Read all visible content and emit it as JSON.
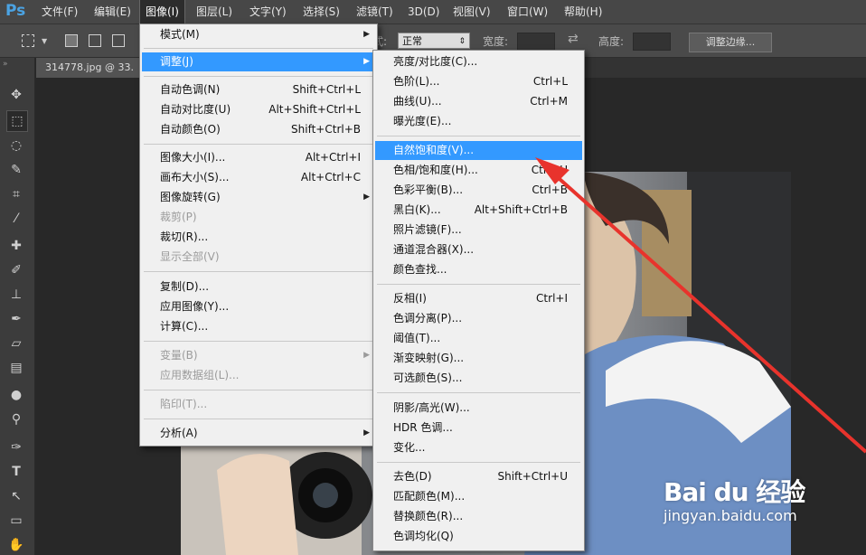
{
  "menubar": {
    "logo": "Ps",
    "items": [
      "文件(F)",
      "编辑(E)",
      "图像(I)",
      "图层(L)",
      "文字(Y)",
      "选择(S)",
      "滤镜(T)",
      "3D(D)",
      "视图(V)",
      "窗口(W)",
      "帮助(H)"
    ],
    "active": "图像(I)"
  },
  "options_bar": {
    "style_label_fragment": "式:",
    "style_value": "正常",
    "width_label": "宽度:",
    "height_label": "高度:",
    "refine_button": "调整边缘..."
  },
  "document_tab": {
    "title": "314778.jpg @ 33."
  },
  "image_menu": {
    "items": [
      {
        "label": "模式(M)",
        "submenu": true
      },
      {
        "label": "调整(J)",
        "submenu": true,
        "highlighted": true
      },
      {
        "label": "自动色调(N)",
        "shortcut": "Shift+Ctrl+L"
      },
      {
        "label": "自动对比度(U)",
        "shortcut": "Alt+Shift+Ctrl+L"
      },
      {
        "label": "自动颜色(O)",
        "shortcut": "Shift+Ctrl+B"
      },
      {
        "label": "图像大小(I)...",
        "shortcut": "Alt+Ctrl+I"
      },
      {
        "label": "画布大小(S)...",
        "shortcut": "Alt+Ctrl+C"
      },
      {
        "label": "图像旋转(G)",
        "submenu": true
      },
      {
        "label": "裁剪(P)",
        "disabled": true
      },
      {
        "label": "裁切(R)..."
      },
      {
        "label": "显示全部(V)",
        "disabled": true
      },
      {
        "label": "复制(D)..."
      },
      {
        "label": "应用图像(Y)..."
      },
      {
        "label": "计算(C)..."
      },
      {
        "label": "变量(B)",
        "submenu": true,
        "disabled": true
      },
      {
        "label": "应用数据组(L)...",
        "disabled": true
      },
      {
        "label": "陷印(T)...",
        "disabled": true
      },
      {
        "label": "分析(A)",
        "submenu": true
      }
    ]
  },
  "adjust_menu": {
    "items": [
      {
        "label": "亮度/对比度(C)..."
      },
      {
        "label": "色阶(L)...",
        "shortcut": "Ctrl+L"
      },
      {
        "label": "曲线(U)...",
        "shortcut": "Ctrl+M"
      },
      {
        "label": "曝光度(E)..."
      },
      {
        "label": "自然饱和度(V)...",
        "highlighted": true
      },
      {
        "label": "色相/饱和度(H)...",
        "shortcut": "Ctrl+U"
      },
      {
        "label": "色彩平衡(B)...",
        "shortcut": "Ctrl+B"
      },
      {
        "label": "黑白(K)...",
        "shortcut": "Alt+Shift+Ctrl+B"
      },
      {
        "label": "照片滤镜(F)..."
      },
      {
        "label": "通道混合器(X)..."
      },
      {
        "label": "颜色查找..."
      },
      {
        "label": "反相(I)",
        "shortcut": "Ctrl+I"
      },
      {
        "label": "色调分离(P)..."
      },
      {
        "label": "阈值(T)..."
      },
      {
        "label": "渐变映射(G)..."
      },
      {
        "label": "可选颜色(S)..."
      },
      {
        "label": "阴影/高光(W)..."
      },
      {
        "label": "HDR 色调..."
      },
      {
        "label": "变化..."
      },
      {
        "label": "去色(D)",
        "shortcut": "Shift+Ctrl+U"
      },
      {
        "label": "匹配颜色(M)..."
      },
      {
        "label": "替换颜色(R)..."
      },
      {
        "label": "色调均化(Q)"
      }
    ]
  },
  "watermark": {
    "brand": "Bai du 经验",
    "url": "jingyan.baidu.com"
  },
  "colors": {
    "highlight": "#3399ff",
    "annotation_arrow": "#e8332c",
    "menu_bg": "#f0f0f0"
  }
}
